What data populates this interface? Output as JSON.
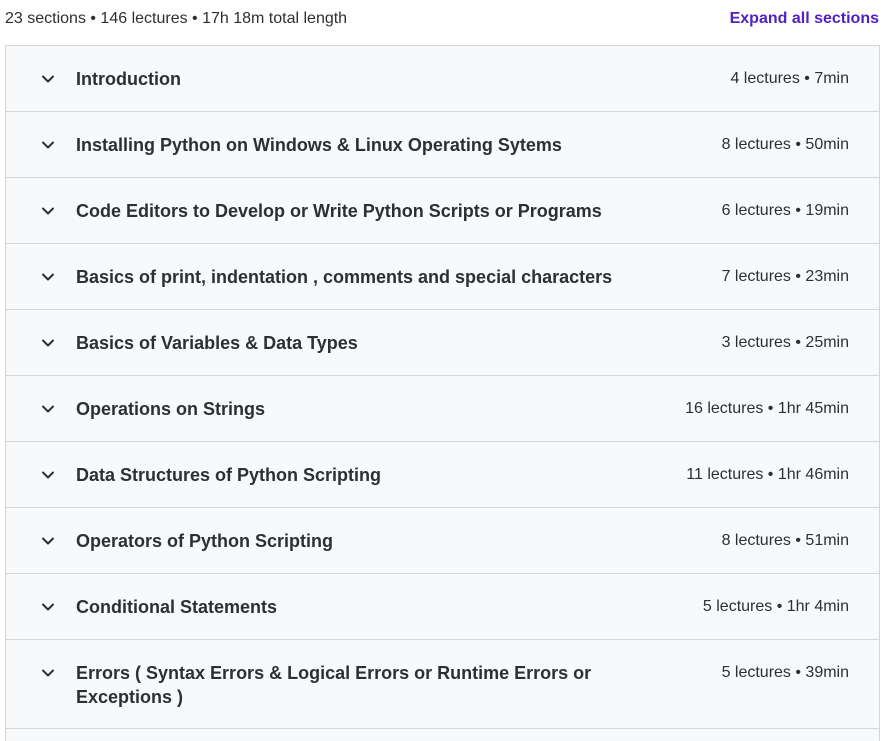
{
  "summary": {
    "text": "23 sections • 146 lectures • 17h 18m total length",
    "expand_label": "Expand all sections"
  },
  "icons": {
    "chevron": "chevron-down-icon"
  },
  "colors": {
    "accent": "#5022c3",
    "row_bg": "#f7f9fa",
    "border": "#d1d7dc",
    "text": "#2d2f31"
  },
  "sections": [
    {
      "title": "Introduction",
      "meta": "4 lectures • 7min"
    },
    {
      "title": "Installing Python on Windows & Linux Operating Sytems",
      "meta": "8 lectures • 50min"
    },
    {
      "title": "Code Editors to Develop or Write Python Scripts or Programs",
      "meta": "6 lectures • 19min"
    },
    {
      "title": "Basics of print, indentation , comments and special characters",
      "meta": "7 lectures • 23min"
    },
    {
      "title": "Basics of Variables & Data Types",
      "meta": "3 lectures • 25min"
    },
    {
      "title": "Operations on Strings",
      "meta": "16 lectures • 1hr 45min"
    },
    {
      "title": "Data Structures of Python Scripting",
      "meta": "11 lectures • 1hr 46min"
    },
    {
      "title": "Operators of Python Scripting",
      "meta": "8 lectures • 51min"
    },
    {
      "title": "Conditional Statements",
      "meta": "5 lectures • 1hr 4min"
    },
    {
      "title": "Errors ( Syntax Errors & Logical Errors or Runtime Errors or Exceptions )",
      "meta": "5 lectures • 39min"
    }
  ]
}
